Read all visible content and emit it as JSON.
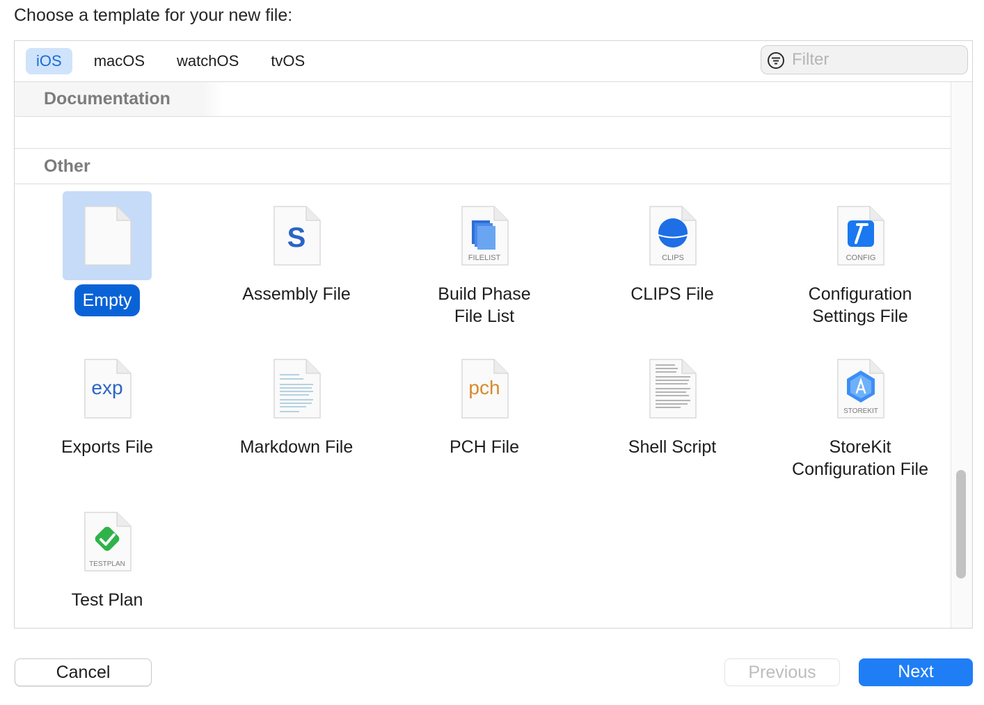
{
  "prompt": "Choose a template for your new file:",
  "tabs": [
    {
      "label": "iOS",
      "active": true
    },
    {
      "label": "macOS",
      "active": false
    },
    {
      "label": "watchOS",
      "active": false
    },
    {
      "label": "tvOS",
      "active": false
    }
  ],
  "filter": {
    "placeholder": "Filter",
    "icon": "filter-icon"
  },
  "sections": {
    "documentation": "Documentation",
    "other": "Other"
  },
  "templates": [
    {
      "label": "Empty",
      "icon": "empty-file-icon",
      "selected": true
    },
    {
      "label": "Assembly File",
      "icon": "assembly-file-icon",
      "badge": "S"
    },
    {
      "label": "Build Phase\nFile List",
      "line1": "Build Phase",
      "line2": "File List",
      "icon": "filelist-icon",
      "badge": "FILELIST"
    },
    {
      "label": "CLIPS File",
      "icon": "clips-file-icon",
      "badge": "CLIPS"
    },
    {
      "label": "Configuration\nSettings File",
      "line1": "Configuration",
      "line2": "Settings File",
      "icon": "config-file-icon",
      "badge": "CONFIG"
    },
    {
      "label": "Exports File",
      "icon": "exports-file-icon",
      "badge": "exp"
    },
    {
      "label": "Markdown File",
      "icon": "markdown-file-icon"
    },
    {
      "label": "PCH File",
      "icon": "pch-file-icon",
      "badge": "pch"
    },
    {
      "label": "Shell Script",
      "icon": "shell-script-icon"
    },
    {
      "label": "StoreKit\nConfiguration File",
      "line1": "StoreKit",
      "line2": "Configuration File",
      "icon": "storekit-file-icon",
      "badge": "STOREKIT"
    },
    {
      "label": "Test Plan",
      "icon": "testplan-file-icon",
      "badge": "TESTPLAN"
    }
  ],
  "buttons": {
    "cancel": "Cancel",
    "previous": "Previous",
    "next": "Next"
  },
  "colors": {
    "accent": "#0a63d6",
    "next_button": "#1f7ef5",
    "active_tab_bg": "#cfe3fb",
    "selection_bg": "#c6dbf7"
  }
}
